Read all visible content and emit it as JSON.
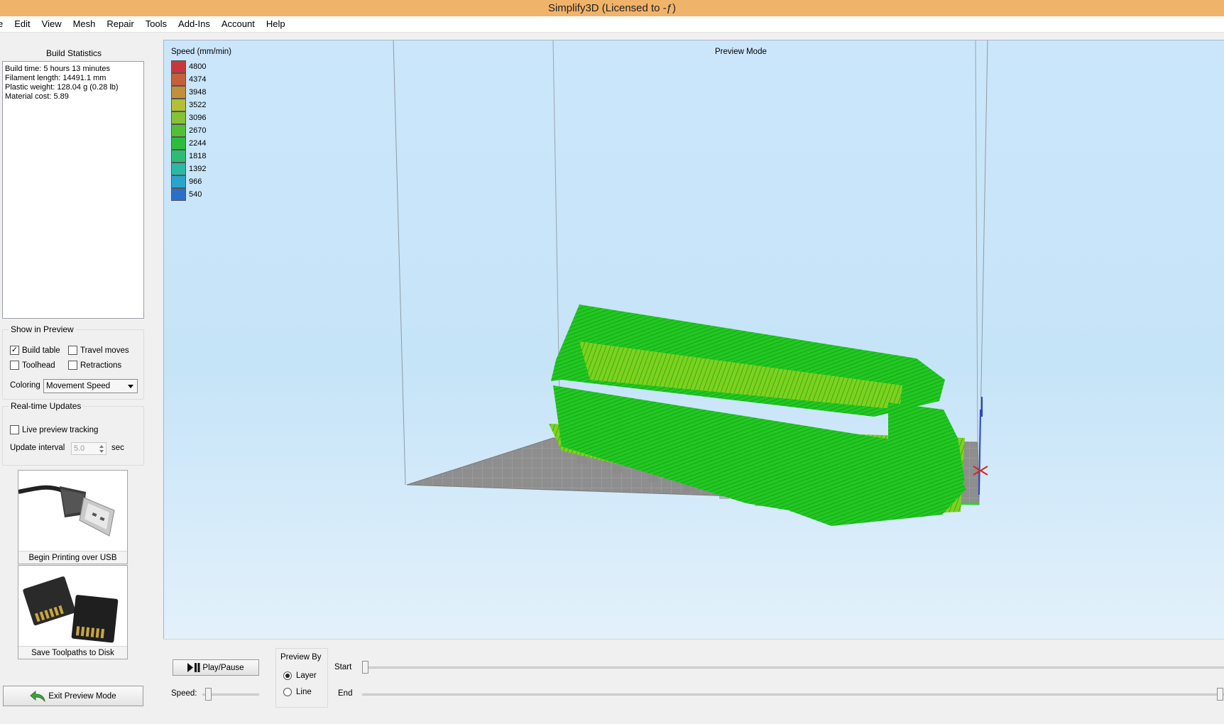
{
  "window": {
    "title": "Simplify3D (Licensed to -ƒ)"
  },
  "menu": [
    "e",
    "Edit",
    "View",
    "Mesh",
    "Repair",
    "Tools",
    "Add-Ins",
    "Account",
    "Help"
  ],
  "build_statistics": {
    "title": "Build Statistics",
    "lines": [
      "Build time: 5 hours 13 minutes",
      "Filament length: 14491.1 mm",
      "Plastic weight: 128.04 g (0.28 lb)",
      "Material cost: 5.89"
    ]
  },
  "show_in_preview": {
    "title": "Show in Preview",
    "build_table": {
      "label": "Build table",
      "checked": true
    },
    "travel_moves": {
      "label": "Travel moves",
      "checked": false
    },
    "toolhead": {
      "label": "Toolhead",
      "checked": false
    },
    "retractions": {
      "label": "Retractions",
      "checked": false
    },
    "coloring_label": "Coloring",
    "coloring_value": "Movement Speed"
  },
  "realtime": {
    "title": "Real-time Updates",
    "live_tracking": {
      "label": "Live preview tracking",
      "checked": false
    },
    "interval_label": "Update interval",
    "interval_value": "5.0",
    "interval_unit": "sec"
  },
  "actions": {
    "usb_label": "Begin Printing over USB",
    "sd_label": "Save Toolpaths to Disk",
    "exit_label": "Exit Preview Mode"
  },
  "viewport": {
    "mode_label": "Preview Mode",
    "legend_title": "Speed (mm/min)",
    "legend": [
      {
        "value": "4800",
        "color": "#c8383a"
      },
      {
        "value": "4374",
        "color": "#c4613a"
      },
      {
        "value": "3948",
        "color": "#c29038"
      },
      {
        "value": "3522",
        "color": "#b2c034"
      },
      {
        "value": "3096",
        "color": "#86c233"
      },
      {
        "value": "2670",
        "color": "#52c033"
      },
      {
        "value": "2244",
        "color": "#2dbd3e"
      },
      {
        "value": "1818",
        "color": "#2cbd73"
      },
      {
        "value": "1392",
        "color": "#2bb9a4"
      },
      {
        "value": "966",
        "color": "#2aa4cc"
      },
      {
        "value": "540",
        "color": "#2b6fc9"
      }
    ],
    "model_color": "#22c822",
    "bed_color": "#8e8e8e"
  },
  "playback": {
    "play_label": "Play/Pause",
    "speed_label": "Speed:",
    "speed_fraction": 0.05,
    "preview_by_title": "Preview By",
    "layer_label": "Layer",
    "line_label": "Line",
    "selected": "Layer",
    "start_label": "Start",
    "end_label": "End",
    "start_fraction": 0.0,
    "end_fraction": 1.0
  }
}
